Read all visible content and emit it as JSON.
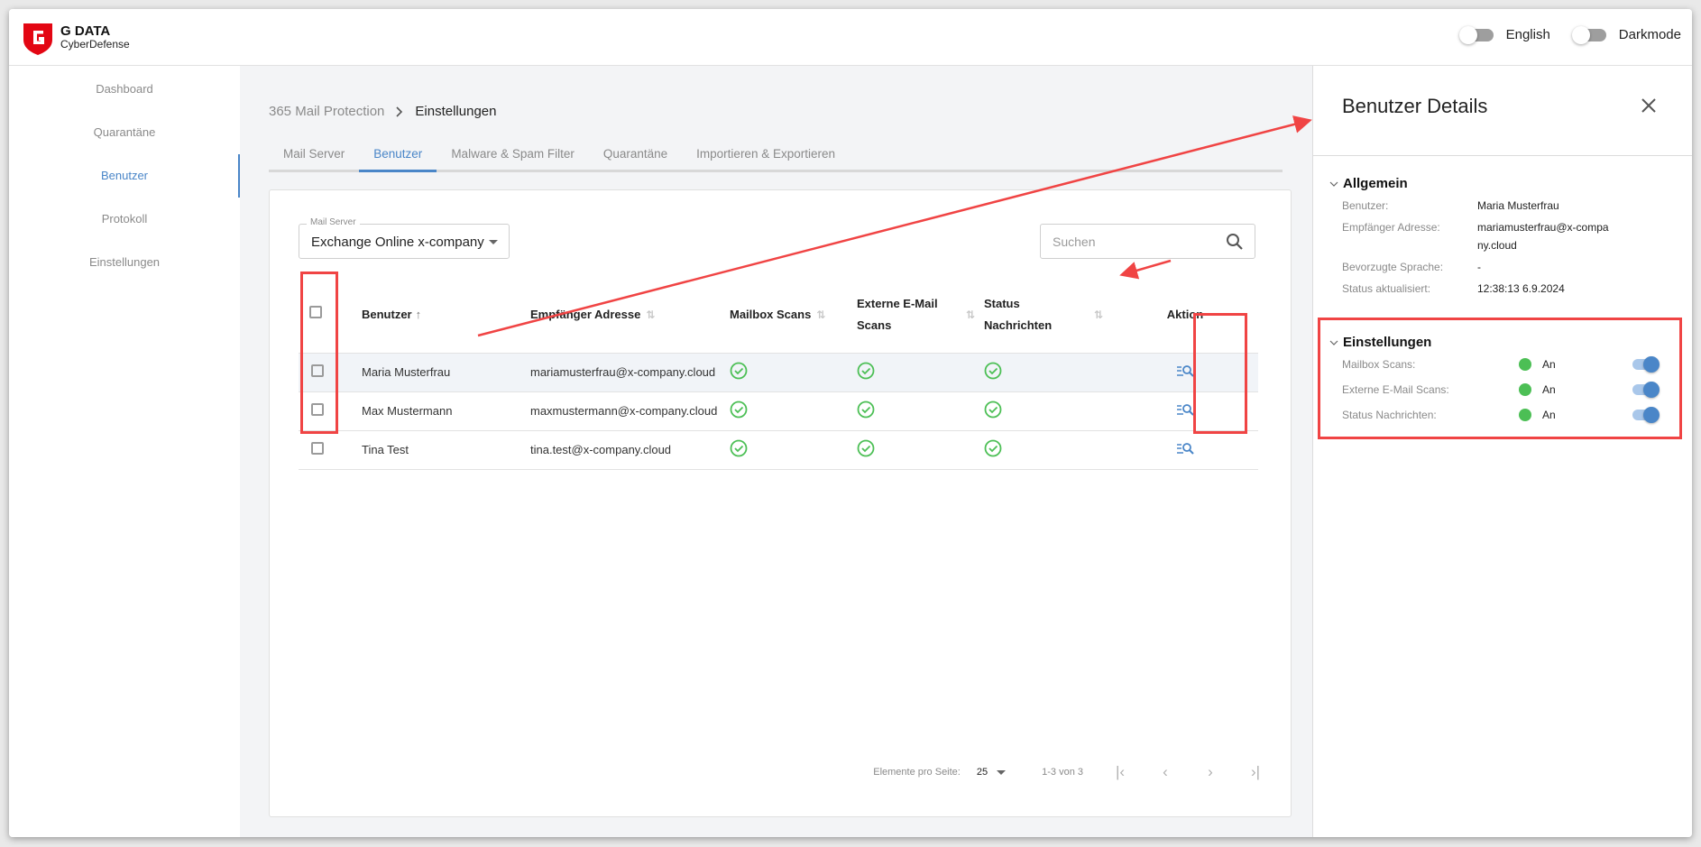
{
  "header": {
    "brand_title": "G DATA",
    "brand_subtitle": "CyberDefense",
    "toggles": [
      {
        "label": "English",
        "state": "off"
      },
      {
        "label": "Darkmode",
        "state": "off"
      }
    ]
  },
  "sidebar": {
    "items": [
      {
        "label": "Dashboard",
        "active": false
      },
      {
        "label": "Quarantäne",
        "active": false
      },
      {
        "label": "Benutzer",
        "active": true
      },
      {
        "label": "Protokoll",
        "active": false
      },
      {
        "label": "Einstellungen",
        "active": false
      }
    ]
  },
  "breadcrumb": {
    "parent": "365 Mail Protection",
    "separator": ">",
    "current": "Einstellungen"
  },
  "tabs": [
    {
      "label": "Mail Server",
      "active": false
    },
    {
      "label": "Benutzer",
      "active": true
    },
    {
      "label": "Malware & Spam Filter",
      "active": false
    },
    {
      "label": "Quarantäne",
      "active": false
    },
    {
      "label": "Importieren & Exportieren",
      "active": false
    }
  ],
  "filters": {
    "mail_server_label": "Mail Server",
    "mail_server_value": "Exchange Online x-company",
    "search_placeholder": "Suchen"
  },
  "table": {
    "columns": [
      {
        "label": "Benutzer",
        "sort": "asc"
      },
      {
        "label": "Empfänger Adresse",
        "sort": "none"
      },
      {
        "label": "Mailbox Scans",
        "sort": "none"
      },
      {
        "label": "Externe E-Mail Scans",
        "sort": "none"
      },
      {
        "label": "Status Nachrichten",
        "sort": "none"
      },
      {
        "label": "Aktion",
        "sort": null
      }
    ],
    "rows": [
      {
        "name": "Maria Musterfrau",
        "email": "mariamusterfrau@x-company.cloud",
        "mailbox_scans": "ok",
        "external_scans": "ok",
        "status_messages": "ok",
        "selected": false,
        "highlighted": true
      },
      {
        "name": "Max Mustermann",
        "email": "maxmustermann@x-company.cloud",
        "mailbox_scans": "ok",
        "external_scans": "ok",
        "status_messages": "ok",
        "selected": false,
        "highlighted": false
      },
      {
        "name": "Tina Test",
        "email": "tina.test@x-company.cloud",
        "mailbox_scans": "ok",
        "external_scans": "ok",
        "status_messages": "ok",
        "selected": false,
        "highlighted": false
      }
    ]
  },
  "pagination": {
    "per_page_label": "Elemente pro Seite:",
    "per_page_value": "25",
    "range": "1-3 von 3"
  },
  "details_panel": {
    "title": "Benutzer Details",
    "general": {
      "heading": "Allgemein",
      "fields": [
        {
          "label": "Benutzer:",
          "value": "Maria Musterfrau"
        },
        {
          "label": "Empfänger Adresse:",
          "value": "mariamusterfrau@x-company.cloud"
        },
        {
          "label": "Bevorzugte Sprache:",
          "value": "-"
        },
        {
          "label": "Status aktualisiert:",
          "value": "12:38:13 6.9.2024"
        }
      ]
    },
    "settings": {
      "heading": "Einstellungen",
      "items": [
        {
          "label": "Mailbox Scans:",
          "status": "An",
          "enabled": true
        },
        {
          "label": "Externe E-Mail Scans:",
          "status": "An",
          "enabled": true
        },
        {
          "label": "Status Nachrichten:",
          "status": "An",
          "enabled": true
        }
      ]
    }
  },
  "colors": {
    "accent": "#4a86c8",
    "success": "#4cbf55",
    "brand_red": "#e30613",
    "annotation_red": "#f04444"
  }
}
